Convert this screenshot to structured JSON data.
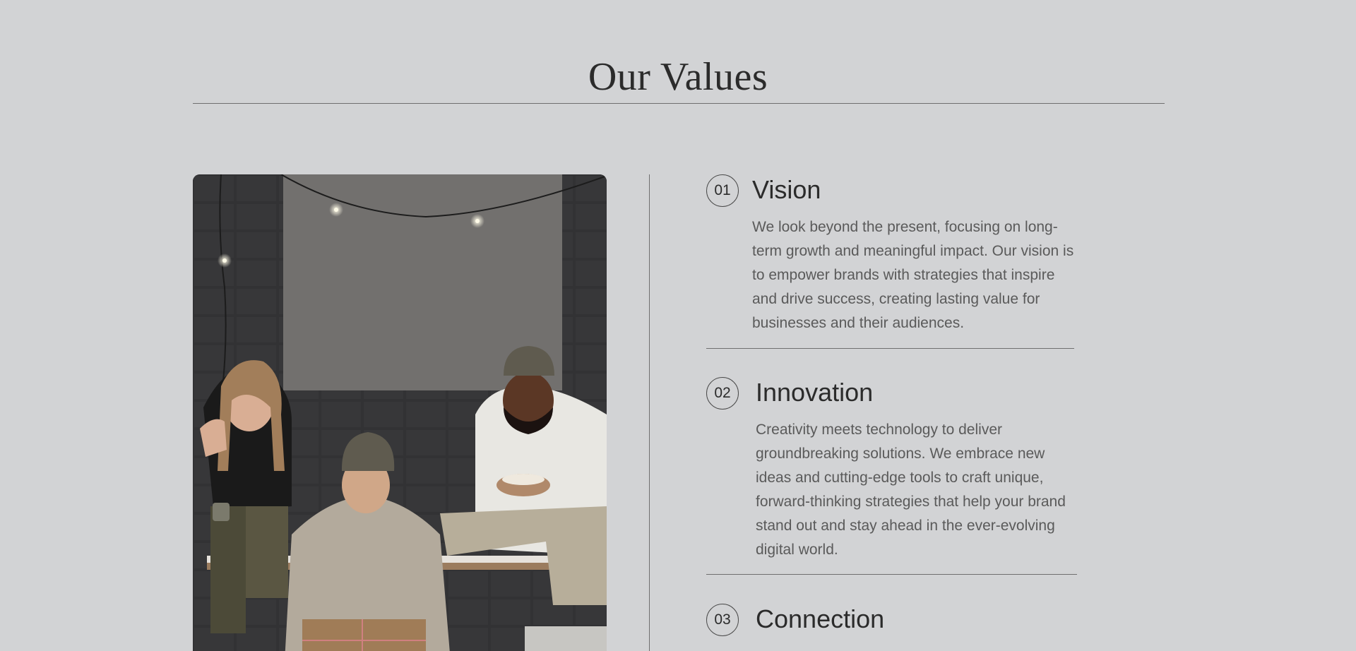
{
  "section": {
    "title": "Our Values"
  },
  "photo": {
    "icon": "team-photo"
  },
  "values": [
    {
      "number": "01",
      "title": "Vision",
      "description": "We look beyond the present, focusing on long-term growth and meaningful impact. Our vision is to empower brands with strategies that inspire and drive success, creating lasting value for businesses and their audiences."
    },
    {
      "number": "02",
      "title": "Innovation",
      "description": "Creativity meets technology to deliver groundbreaking solutions. We embrace new ideas and cutting-edge tools to craft unique, forward-thinking strategies that help your brand stand out and stay ahead in the ever-evolving digital world."
    },
    {
      "number": "03",
      "title": "Connection",
      "description": ""
    }
  ]
}
